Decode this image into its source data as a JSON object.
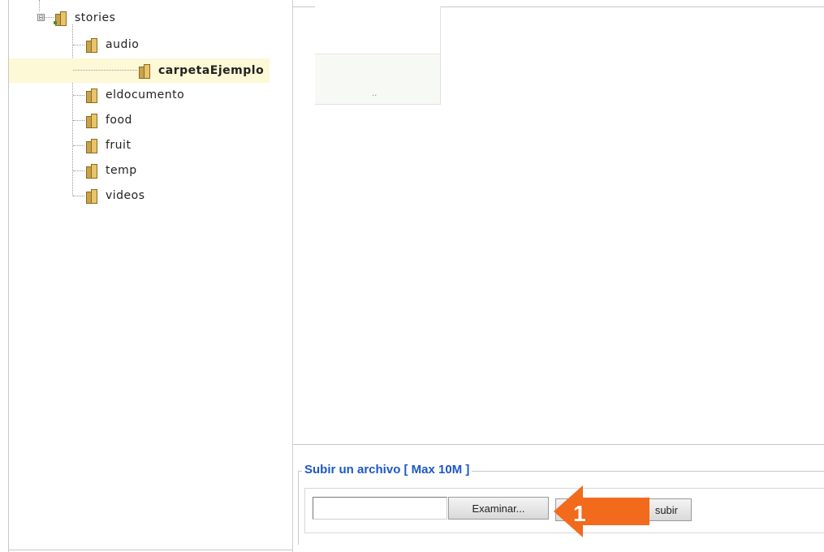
{
  "tree": {
    "root": {
      "label": "stories",
      "toggle_symbol": "⊟"
    },
    "children": [
      {
        "label": "audio",
        "selected": false
      },
      {
        "label": "carpetaEjemplo",
        "selected": true
      },
      {
        "label": "eldocumento",
        "selected": false
      },
      {
        "label": "food",
        "selected": false
      },
      {
        "label": "fruit",
        "selected": false
      },
      {
        "label": "temp",
        "selected": false
      },
      {
        "label": "videos",
        "selected": false
      }
    ]
  },
  "file_list": {
    "parent_entry_label": ".."
  },
  "upload": {
    "legend": "Subir un archivo [ Max 10M ]",
    "file_input_value": "",
    "browse_label": "Examinar...",
    "upload_label": "subir"
  },
  "annotation": {
    "step_number": "1",
    "color": "#f26a1b"
  },
  "colors": {
    "selected_row_bg": "#fdf8d6",
    "legend_text": "#1b57c7",
    "folder_gold": "#e8c46a"
  }
}
